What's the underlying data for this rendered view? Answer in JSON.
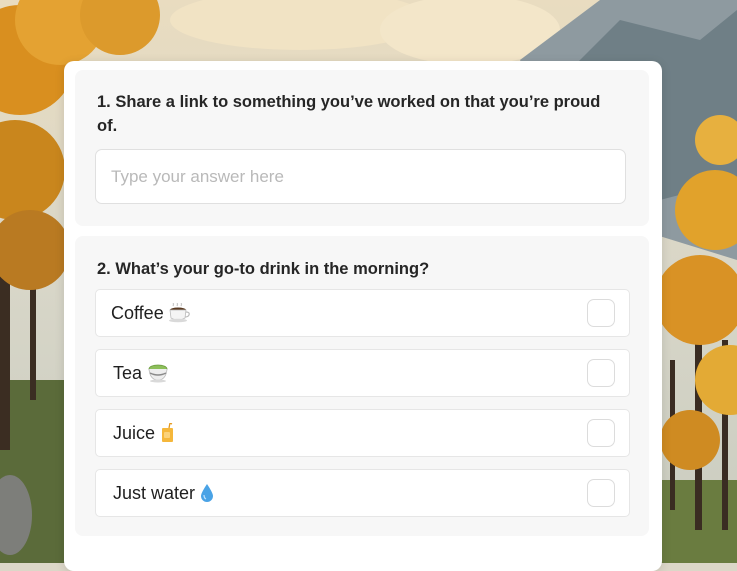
{
  "survey": {
    "questions": [
      {
        "number": "1.",
        "text": "Share a link to something you’ve worked on that you’re proud of.",
        "input_placeholder": "Type your answer here",
        "input_value": ""
      },
      {
        "number": "2.",
        "text": "What’s your go-to drink in the morning?",
        "options": [
          {
            "label": "Coffee",
            "emoji": "hot-beverage-icon",
            "checked": false
          },
          {
            "label": "Tea",
            "emoji": "matcha-tea-icon",
            "checked": false
          },
          {
            "label": "Juice",
            "emoji": "juice-box-icon",
            "checked": false
          },
          {
            "label": "Just water",
            "emoji": "droplet-icon",
            "checked": false
          }
        ]
      }
    ]
  },
  "colors": {
    "card_bg": "#ffffff",
    "section_bg": "#f7f7f7",
    "question_text": "#262626",
    "placeholder_text": "#b9b9b9",
    "border": "#e0e0e0"
  }
}
